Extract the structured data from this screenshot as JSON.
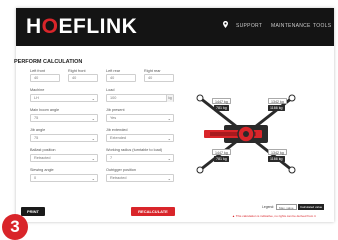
{
  "header": {
    "logo_h": "H",
    "logo_o": "O",
    "logo_rest": "EFLINK",
    "nav_pin": "⬤",
    "nav": [
      "SUPPORT",
      "MAINTENANCE",
      "TOOLS"
    ]
  },
  "form": {
    "title": "PERFORM CALCULATION",
    "fields": {
      "left_front": {
        "label": "Left front",
        "value": "40"
      },
      "right_front": {
        "label": "Right front",
        "value": "40"
      },
      "left_rear": {
        "label": "Left rear",
        "value": "40"
      },
      "right_rear": {
        "label": "Right rear",
        "value": "40"
      },
      "machine": {
        "label": "Machine",
        "value": "LH"
      },
      "load": {
        "label": "Load",
        "value": "100",
        "unit": "kg"
      },
      "main_boom_angle": {
        "label": "Main boom angle",
        "value": "75"
      },
      "jib_present": {
        "label": "Jib present",
        "value": "Yes"
      },
      "jib_angle": {
        "label": "Jib angle",
        "value": "75"
      },
      "jib_extended": {
        "label": "Jib extended",
        "value": "Extended"
      },
      "ballast_position": {
        "label": "Ballast position",
        "value": "Retracted"
      },
      "working_radius": {
        "label": "Working radius (turntable to load)",
        "value": "7"
      },
      "slewing_angle": {
        "label": "Slewing angle",
        "value": "0"
      },
      "outrigger_position": {
        "label": "Outrigger position",
        "value": "Retracted"
      }
    }
  },
  "buttons": {
    "print": "PRINT",
    "recalculate": "RECALCULATE"
  },
  "diagram": {
    "loads": {
      "front_left": {
        "max": "1447 kg",
        "calc": "781 kg"
      },
      "front_right": {
        "max": "1342 kg",
        "calc": "1166 kg"
      },
      "rear_left": {
        "max": "1447 kg",
        "calc": "781 kg"
      },
      "rear_right": {
        "max": "1342 kg",
        "calc": "1166 kg"
      }
    },
    "colors": {
      "accent": "#d9252a",
      "dark": "#1a1a1a"
    }
  },
  "legend": {
    "label": "Legend:",
    "max": "Max. value",
    "calc": "Calculated value",
    "note": "▲ This calculation is indicative, no rights can be derived from it"
  },
  "step_badge": "3"
}
